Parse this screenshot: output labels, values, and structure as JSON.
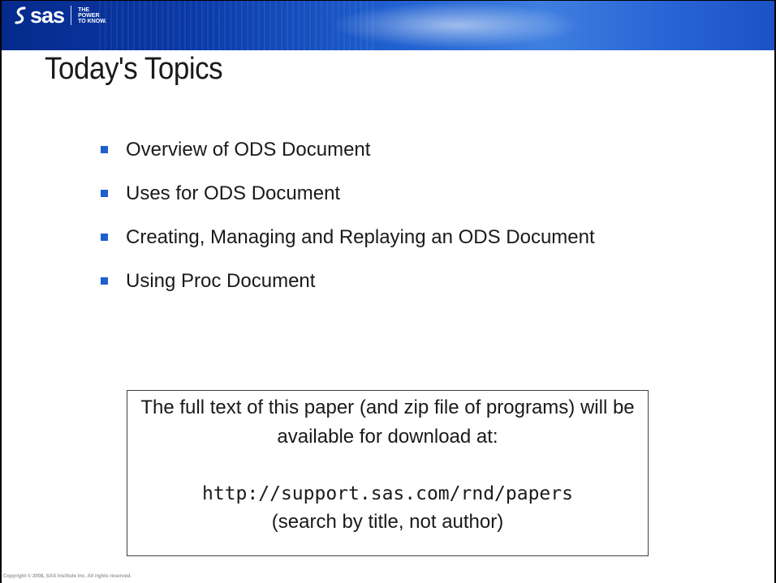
{
  "header": {
    "logo_text": "sas",
    "tagline": [
      "THE",
      "POWER",
      "TO KNOW."
    ],
    "colors": {
      "band_dark": "#062a8c",
      "band_light": "#3f7fe0"
    }
  },
  "slide": {
    "title": "Today's Topics",
    "topics": [
      "Overview of ODS Document",
      "Uses for ODS Document",
      "Creating, Managing and Replaying an ODS Document",
      "Using Proc Document"
    ],
    "bullet_color": "#1f5fcf"
  },
  "notice": {
    "text": "The full text of this paper (and zip file of programs) will be available for download at:",
    "url": "http://support.sas.com/rnd/papers",
    "search_hint": "(search by title, not author)"
  },
  "footer": {
    "copyright": "Copyright © 2008, SAS Institute Inc. All rights reserved."
  }
}
